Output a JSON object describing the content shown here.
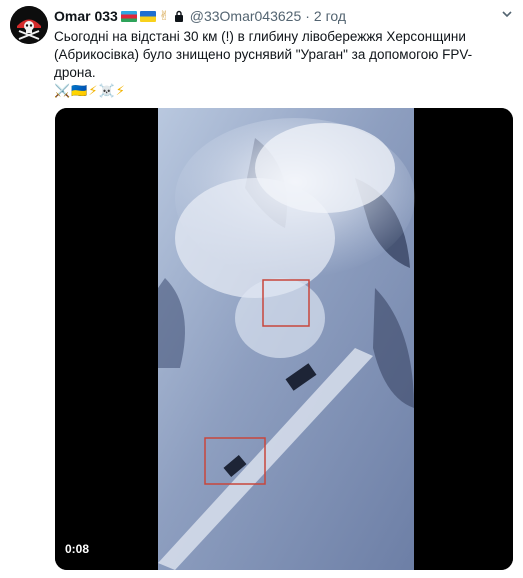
{
  "tweet": {
    "display_name": "Omar 033",
    "handle": "@33Omar043625",
    "separator": "·",
    "time_ago": "2 год",
    "text_line1": "Сьогодні на відстані 30 км (!) в глибину лівобережжя Херсонщини",
    "text_line2": "(Абрикосівка) було знищено руснявий \"Ураган\" за допомогою FPV-",
    "text_line3": "дрона.",
    "emojis": "⚔️🇺🇦⚡☠️⚡"
  },
  "media": {
    "video_timestamp": "0:08"
  },
  "icons": {
    "avatar": "jolly-roger-avatar",
    "lock": "lock-icon",
    "more": "chevron-down-icon",
    "hand": "victory-hand-icon",
    "flag1": "azerbaijan-flag-icon",
    "flag2": "ukraine-flag-icon"
  },
  "colors": {
    "text": "#0f1419",
    "secondary": "#536471",
    "video_bg": "#000000",
    "target_box": "#c8463c"
  }
}
